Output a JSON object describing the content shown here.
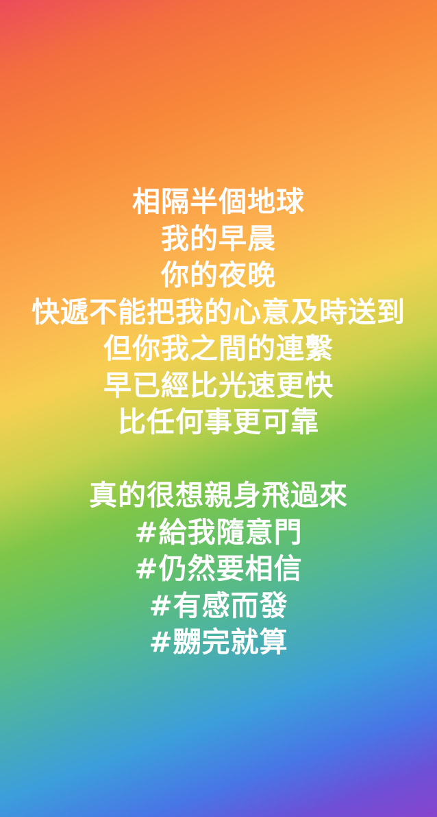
{
  "story": {
    "lines": [
      "相隔半個地球",
      "我的早晨",
      "你的夜晚",
      "快遞不能把我的心意及時送到",
      "但你我之間的連繫",
      "早已經比光速更快",
      "比任何事更可靠"
    ],
    "lines2": [
      "真的很想親身飛過來",
      "#給我隨意門",
      "#仍然要相信",
      "#有感而發",
      "#嬲完就算"
    ]
  }
}
